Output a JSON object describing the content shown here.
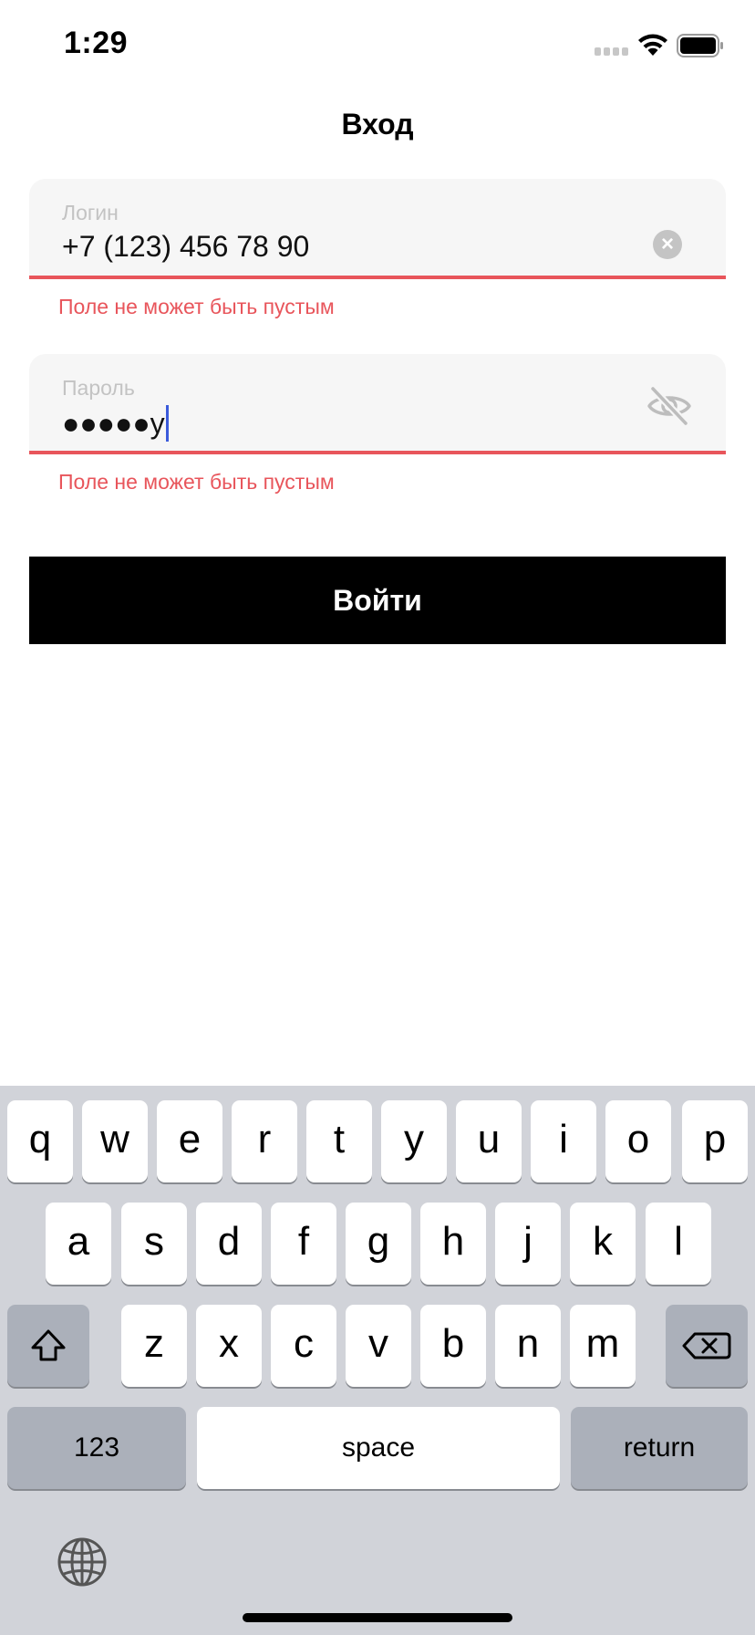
{
  "status_bar": {
    "time": "1:29"
  },
  "header": {
    "title": "Вход"
  },
  "login_field": {
    "label": "Логин",
    "value": "+7 (123) 456 78 90",
    "error": "Поле не может быть пустым"
  },
  "password_field": {
    "label": "Пароль",
    "value": "●●●●●y",
    "error": "Поле не может быть пустым"
  },
  "submit": {
    "label": "Войти"
  },
  "colors": {
    "error": "#e8555b",
    "button_bg": "#000000",
    "field_bg": "#f6f6f6",
    "cursor": "#3b5bdb"
  },
  "icons": {
    "clear": "clear-circle-icon",
    "visibility": "eye-slash-icon",
    "shift": "shift-icon",
    "backspace": "backspace-icon",
    "globe": "globe-icon"
  },
  "keyboard": {
    "row1": [
      "q",
      "w",
      "e",
      "r",
      "t",
      "y",
      "u",
      "i",
      "o",
      "p"
    ],
    "row2": [
      "a",
      "s",
      "d",
      "f",
      "g",
      "h",
      "j",
      "k",
      "l"
    ],
    "row3": [
      "z",
      "x",
      "c",
      "v",
      "b",
      "n",
      "m"
    ],
    "numbers_label": "123",
    "space_label": "space",
    "return_label": "return"
  }
}
